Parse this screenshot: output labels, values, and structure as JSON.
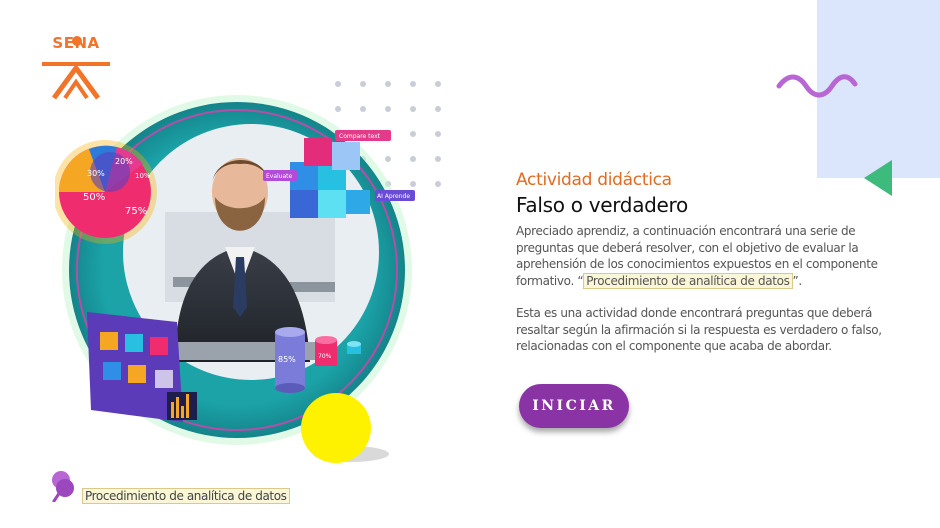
{
  "logo": {
    "text": "SENA"
  },
  "activity": {
    "kicker": "Actividad didáctica",
    "title": "Falso o verdadero",
    "paragraph1_start": "Apreciado aprendiz, a continuación encontrará una serie de preguntas que deberá resolver, con el objetivo de evaluar la aprehensión de los conocimientos expuestos en el componente formativo. “",
    "paragraph1_highlight": "Procedimiento de analítica de datos",
    "paragraph1_end": "”.",
    "paragraph2": "Esta es una actividad donde encontrará preguntas que deberá resaltar según la afirmación si la respuesta es verdadero o falso, relacionadas con el componente que acaba de abordar."
  },
  "start_button": {
    "label": "INICIAR"
  },
  "footer": {
    "component_label": "Procedimiento de analítica de datos"
  },
  "illustration": {
    "pie_labels": [
      "20%",
      "30%",
      "10%",
      "50%",
      "75%"
    ],
    "cylinder_label": "85%",
    "cylinder_label_2": "70%",
    "cube_tags": [
      "Compare text",
      "Evaluate",
      "AI Aprende"
    ]
  },
  "colors": {
    "accent_orange": "#e26a22",
    "button_purple": "#8a33a4",
    "teal": "#1ba3a8",
    "yellow": "#fff200",
    "light_blue": "#dbe5fb",
    "green_triangle": "#3dbb7c",
    "squiggle_purple": "#b866d3"
  }
}
